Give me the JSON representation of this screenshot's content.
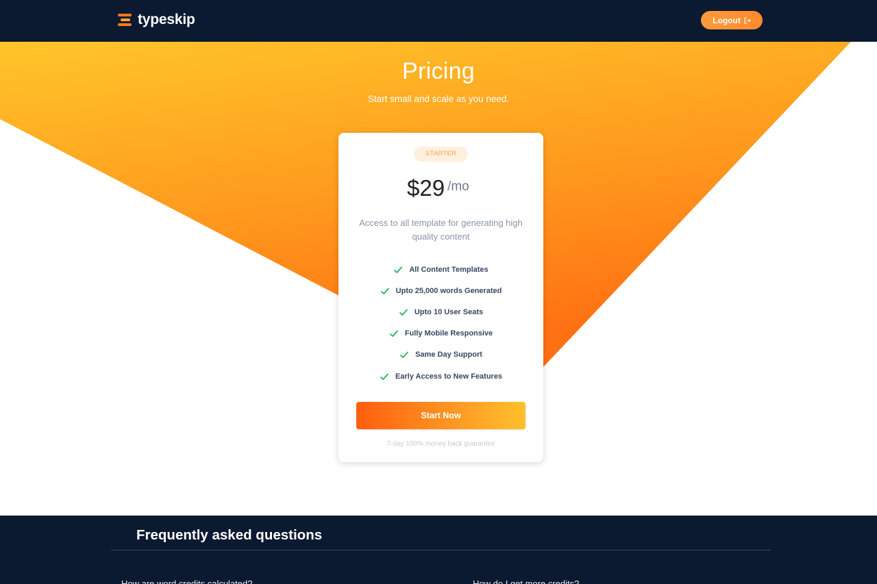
{
  "brand": {
    "name": "typeskip"
  },
  "nav": {
    "logout_label": "Logout"
  },
  "hero": {
    "title": "Pricing",
    "subtitle": "Start small and scale as you need."
  },
  "plan": {
    "badge": "STARTER",
    "price": "$29",
    "unit": "/mo",
    "description": "Access to all template for generating high quality content",
    "features": [
      "All Content Templates",
      "Upto 25,000 words Generated",
      "Upto 10 User Seats",
      "Fully Mobile Responsive",
      "Same Day Support",
      "Early Access to New Features"
    ],
    "cta_label": "Start Now",
    "guarantee": "7-day 100% money back guarantee"
  },
  "faq": {
    "title": "Frequently asked questions",
    "questions": [
      "How are word credits calculated?",
      "How do I get more credits?"
    ]
  },
  "colors": {
    "navy": "#0b1a31",
    "orange": "#ff8a1e",
    "yellow": "#ffc02a",
    "check_green": "#22b35e"
  },
  "icons": {
    "logo": "typeskip-logo-icon",
    "logout": "logout-icon",
    "feature": "check-icon"
  }
}
